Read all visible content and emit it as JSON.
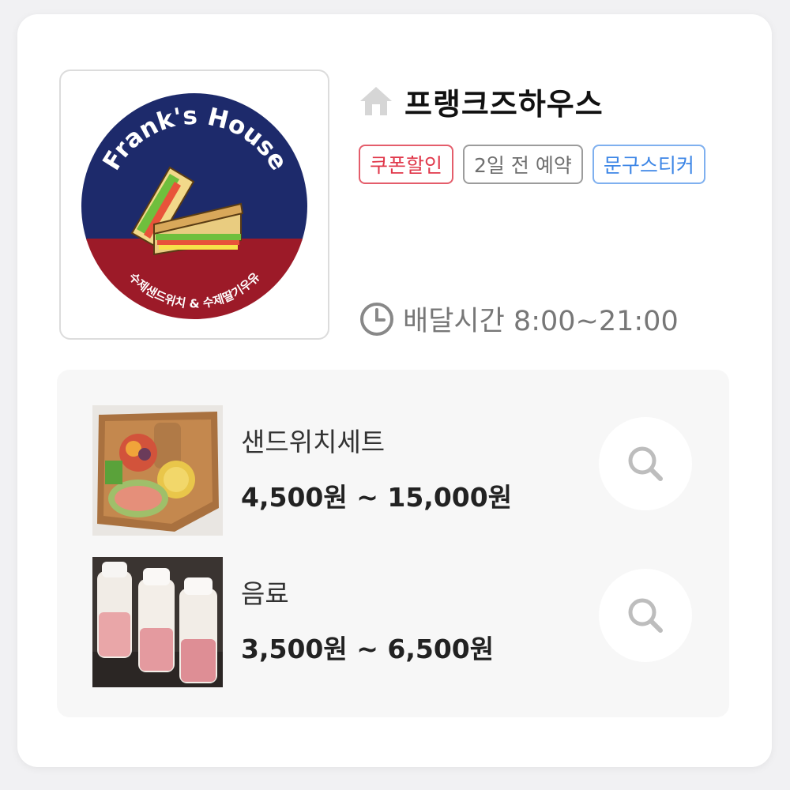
{
  "shop": {
    "name": "프랭크즈하우스",
    "logo": {
      "brand_text": "Frank's House",
      "sub_text": "수제샌드위치 & 수제딸기우유",
      "top_color": "#1d2a6b",
      "bottom_color": "#9c1a28"
    }
  },
  "badges": [
    {
      "label": "쿠폰할인",
      "color": "#e0374a"
    },
    {
      "label": "2일 전 예약",
      "color": "#6f6f6f"
    },
    {
      "label": "문구스티커",
      "color": "#3d86e6"
    }
  ],
  "delivery": {
    "label": "배달시간 8:00~21:00"
  },
  "menu": [
    {
      "name": "샌드위치세트",
      "price": "4,500원 ~ 15,000원"
    },
    {
      "name": "음료",
      "price": "3,500원 ~ 6,500원"
    }
  ],
  "icons": {
    "home": "home-icon",
    "clock": "clock-icon",
    "search": "search-icon"
  }
}
